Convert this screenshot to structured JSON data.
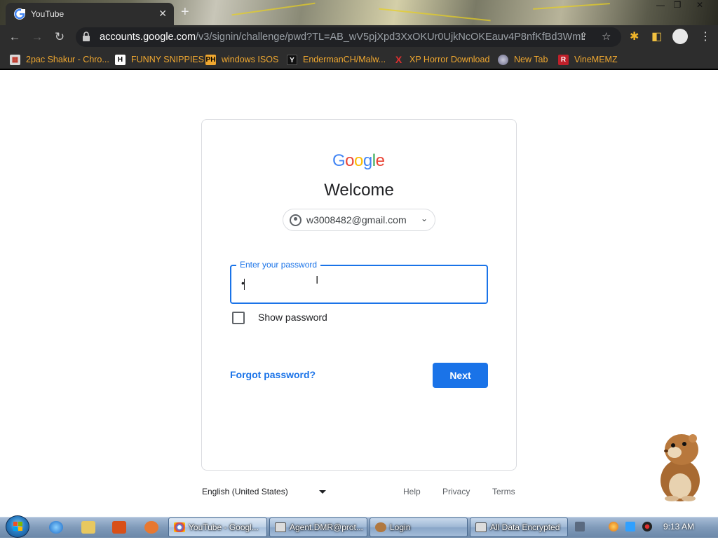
{
  "browser": {
    "tab_title": "YouTube",
    "new_tab_symbol": "+",
    "url_host": "accounts.google.com",
    "url_path": "/v3/signin/challenge/pwd?TL=AB_wV5pjXpd3XxOKUr0UjkNcOKEauv4P8nfKfBd3WmIp...",
    "bookmarks": [
      {
        "label": "2pac Shakur - Chro...",
        "icon": "app-icon",
        "color": "#c0392b"
      },
      {
        "label": "FUNNY SNIPPIES",
        "icon": "H",
        "color": "#ffffff"
      },
      {
        "label": "windows ISOS",
        "icon": "PH",
        "color": "#f0a830"
      },
      {
        "label": "EndermanCH/Malw...",
        "icon": "Y",
        "color": "#222222"
      },
      {
        "label": "XP Horror Download",
        "icon": "X",
        "color": "#e03030"
      },
      {
        "label": "New Tab",
        "icon": "globe-icon",
        "color": "#8a8aa0"
      },
      {
        "label": "VineMEMZ",
        "icon": "R",
        "color": "#c0202a"
      }
    ]
  },
  "signin": {
    "logo": "Google",
    "heading": "Welcome",
    "account_email": "w3008482@gmail.com",
    "password_label": "Enter your password",
    "password_value": "•",
    "show_password_label": "Show password",
    "forgot_label": "Forgot password?",
    "next_label": "Next"
  },
  "footer": {
    "language": "English (United States)",
    "help": "Help",
    "privacy": "Privacy",
    "terms": "Terms"
  },
  "taskbar": {
    "windows": [
      {
        "label": "YouTube - Googl...",
        "active": true
      },
      {
        "label": "Agent.DMR@prot...",
        "active": false
      },
      {
        "label": "Login",
        "active": false
      },
      {
        "label": "All Data Encrypted",
        "active": false
      }
    ],
    "clock": "9:13 AM"
  },
  "colors": {
    "accent": "#1a73e8",
    "bookmark_text": "#f0a830",
    "google_blue": "#4285f4",
    "google_red": "#ea4335",
    "google_yellow": "#fbbc05",
    "google_green": "#34a853"
  }
}
